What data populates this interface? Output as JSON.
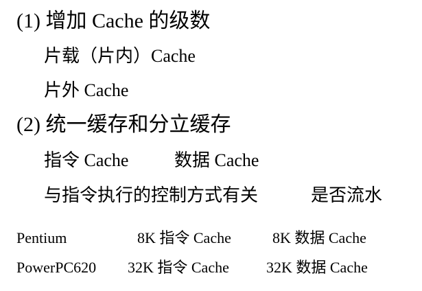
{
  "section1": {
    "heading": "(1) 增加 Cache 的级数",
    "items": [
      "片载（片内）Cache",
      "片外 Cache"
    ]
  },
  "section2": {
    "heading": "(2) 统一缓存和分立缓存",
    "row1": [
      "指令 Cache",
      "数据 Cache"
    ],
    "row2": [
      "与指令执行的控制方式有关",
      "是否流水"
    ]
  },
  "table": {
    "rows": [
      [
        "Pentium",
        "8K 指令 Cache",
        "8K 数据 Cache"
      ],
      [
        "PowerPC620",
        "32K 指令 Cache",
        "32K 数据 Cache"
      ]
    ]
  }
}
